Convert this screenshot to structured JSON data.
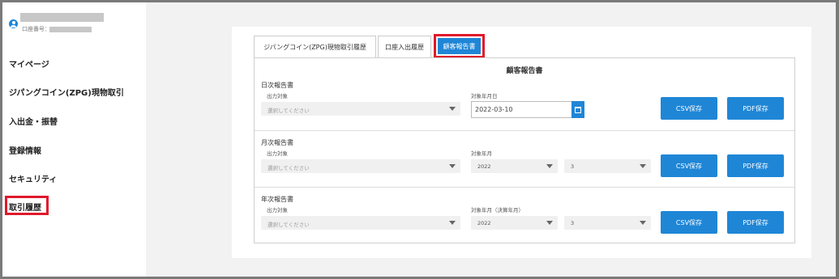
{
  "sidebar": {
    "account_label": "口座番号：",
    "items": [
      {
        "label": "マイページ"
      },
      {
        "label": "ジパングコイン(ZPG)現物取引"
      },
      {
        "label": "入出金・振替"
      },
      {
        "label": "登録情報"
      },
      {
        "label": "セキュリティ"
      },
      {
        "label": "取引履歴"
      }
    ]
  },
  "tabs": [
    {
      "label": "ジパングコイン(ZPG)現物取引履歴"
    },
    {
      "label": "口座入出履歴"
    },
    {
      "label": "顧客報告書"
    }
  ],
  "panel": {
    "title": "顧客報告書",
    "daily": {
      "title": "日次報告書",
      "output_label": "出力対象",
      "output_placeholder": "選択してください",
      "date_label": "対象年月日",
      "date_value": "2022-03-10",
      "csv": "CSV保存",
      "pdf": "PDF保存"
    },
    "monthly": {
      "title": "月次報告書",
      "output_label": "出力対象",
      "output_placeholder": "選択してください",
      "date_label": "対象年月",
      "year": "2022",
      "month": "3",
      "csv": "CSV保存",
      "pdf": "PDF保存"
    },
    "annual": {
      "title": "年次報告書",
      "output_label": "出力対象",
      "output_placeholder": "選択してください",
      "date_label": "対象年月（決算年月）",
      "year": "2022",
      "month": "3",
      "csv": "CSV保存",
      "pdf": "PDF保存"
    }
  },
  "colors": {
    "accent": "#1f86d6",
    "highlight": "#e0192b"
  }
}
